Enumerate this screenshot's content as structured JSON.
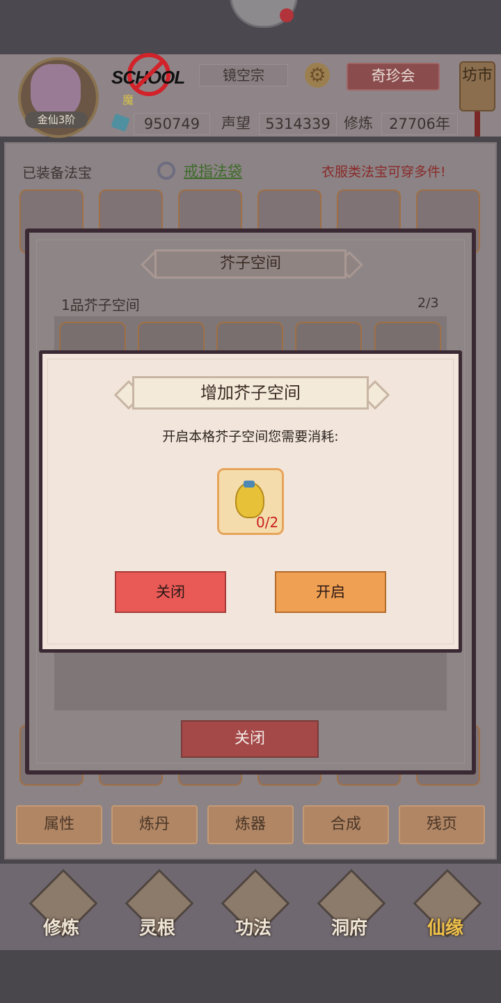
{
  "header": {
    "rank": "金仙3阶",
    "logo_text": "SCHOOL",
    "sub_name": "魔",
    "sect": "镜空宗",
    "treasure_button": "奇珍会",
    "market_button": "坊市",
    "stats": {
      "spirit_stones": "950749",
      "reputation_label": "声望",
      "reputation": "5314339",
      "cultivation_label": "修炼",
      "cultivation": "27706年"
    }
  },
  "equipment": {
    "label": "已装备法宝",
    "ring_bag_link": "戒指法袋",
    "note": "衣服类法宝可穿多件!"
  },
  "bottom_tabs": [
    "属性",
    "炼丹",
    "炼器",
    "合成",
    "残页"
  ],
  "nav": {
    "items": [
      "修炼",
      "灵根",
      "功法",
      "洞府",
      "仙缘"
    ],
    "active_index": 4
  },
  "mustard_dialog": {
    "title": "芥子空间",
    "subtitle": "1品芥子空间",
    "count": "2/3",
    "close_button": "关闭"
  },
  "add_dialog": {
    "title": "增加芥子空间",
    "message": "开启本格芥子空间您需要消耗:",
    "item_icon": "money-bag-icon",
    "item_count": "0/2",
    "close_button": "关闭",
    "open_button": "开启"
  },
  "colors": {
    "close_red": "#e95a56",
    "open_orange": "#f0a052",
    "dialog_bg": "#f2e6dc",
    "count_red": "#c8201f"
  }
}
